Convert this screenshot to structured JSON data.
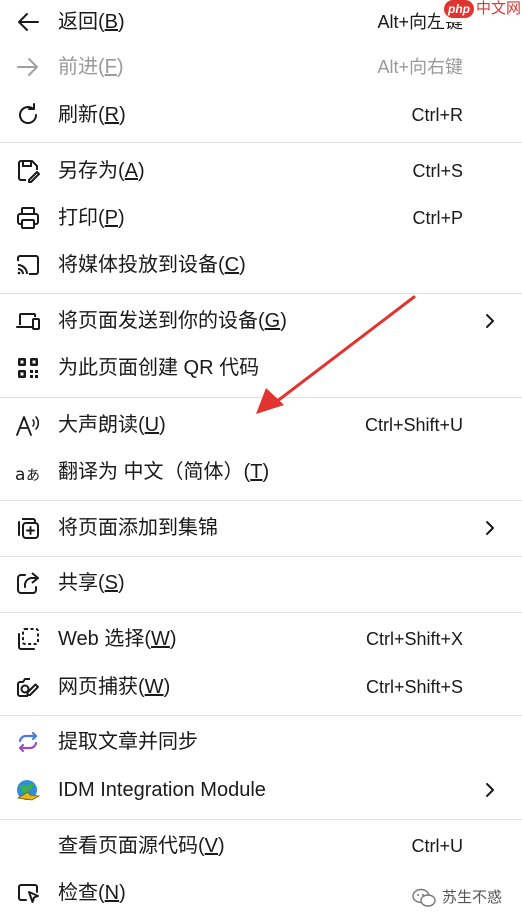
{
  "menu": {
    "back": {
      "label": "返回(",
      "key": "B",
      "end": ")",
      "shortcut": "Alt+向左键"
    },
    "forward": {
      "label": "前进(",
      "key": "F",
      "end": ")",
      "shortcut": "Alt+向右键"
    },
    "refresh": {
      "label": "刷新(",
      "key": "R",
      "end": ")",
      "shortcut": "Ctrl+R"
    },
    "save_as": {
      "label": "另存为(",
      "key": "A",
      "end": ")",
      "shortcut": "Ctrl+S"
    },
    "print": {
      "label": "打印(",
      "key": "P",
      "end": ")",
      "shortcut": "Ctrl+P"
    },
    "cast": {
      "label": "将媒体投放到设备(",
      "key": "C",
      "end": ")"
    },
    "send_to_device": {
      "label": "将页面发送到你的设备(",
      "key": "G",
      "end": ")"
    },
    "qr_code": {
      "label": "为此页面创建 QR 代码"
    },
    "read_aloud": {
      "label": "大声朗读(",
      "key": "U",
      "end": ")",
      "shortcut": "Ctrl+Shift+U"
    },
    "translate": {
      "label": "翻译为 中文（简体）(",
      "key": "T",
      "end": ")"
    },
    "add_to_collections": {
      "label": "将页面添加到集锦"
    },
    "share": {
      "label": "共享(",
      "key": "S",
      "end": ")"
    },
    "web_select": {
      "label": "Web 选择(",
      "key": "W",
      "end": ")",
      "shortcut": "Ctrl+Shift+X"
    },
    "web_capture": {
      "label": "网页捕获(",
      "key": "W",
      "end": ")",
      "shortcut": "Ctrl+Shift+S"
    },
    "extract_sync": {
      "label": "提取文章并同步"
    },
    "idm": {
      "label": "IDM Integration Module"
    },
    "view_source": {
      "label": "查看页面源代码(",
      "key": "V",
      "end": ")",
      "shortcut": "Ctrl+U"
    },
    "inspect": {
      "label": "检查(",
      "key": "N",
      "end": ")"
    }
  },
  "watermark": {
    "badge": "php",
    "site": "中文网",
    "account": "苏生不惑"
  },
  "colors": {
    "accent_arrow": "#e2332e",
    "separator": "#dedede",
    "disabled": "#9a9a9a"
  }
}
